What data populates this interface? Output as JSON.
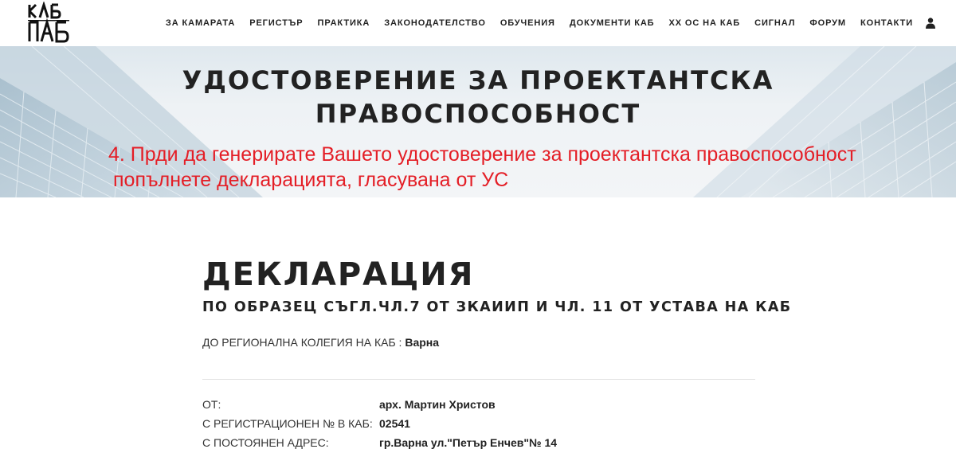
{
  "header": {
    "logo_icon": "kab-logo-icon",
    "nav": [
      "ЗА КАМАРАТА",
      "РЕГИСТЪР",
      "ПРАКТИКА",
      "ЗАКОНОДАТЕЛСТВО",
      "ОБУЧЕНИЯ",
      "ДОКУМЕНТИ КАБ",
      "ХХ ОС НА КАБ",
      "СИГНАЛ",
      "ФОРУМ",
      "КОНТАКТИ"
    ],
    "user_icon": "user-icon"
  },
  "banner": {
    "title_line1": "УДОСТОВЕРЕНИЕ ЗА ПРОЕКТАНТСКА",
    "title_line2": "ПРАВОСПОСОБНОСТ",
    "note_line1": "4. Прди да генерирате Вашето удостоверение за проектантска правоспособност",
    "note_line2": "попълнете декларацията, гласувана от УС",
    "note_color": "#e41e26"
  },
  "declaration": {
    "title": "ДЕКЛАРАЦИЯ",
    "subtitle": "ПО ОБРАЗЕЦ СЪГЛ.ЧЛ.7 ОТ ЗКАИИП И ЧЛ. 11 ОТ УСТАВА НА КАБ",
    "to_label": "ДО РЕГИОНАЛНА КОЛЕГИЯ НА КАБ : ",
    "to_value": "Варна",
    "rows": [
      {
        "label": "ОТ:",
        "value": "арх. Мартин Христов"
      },
      {
        "label": "С РЕГИСТРАЦИОНЕН № В КАБ:",
        "value": "02541"
      },
      {
        "label": "С ПОСТОЯНЕН АДРЕС:",
        "value": "гр.Варна ул.\"Петър Енчев\"№ 14"
      }
    ]
  }
}
